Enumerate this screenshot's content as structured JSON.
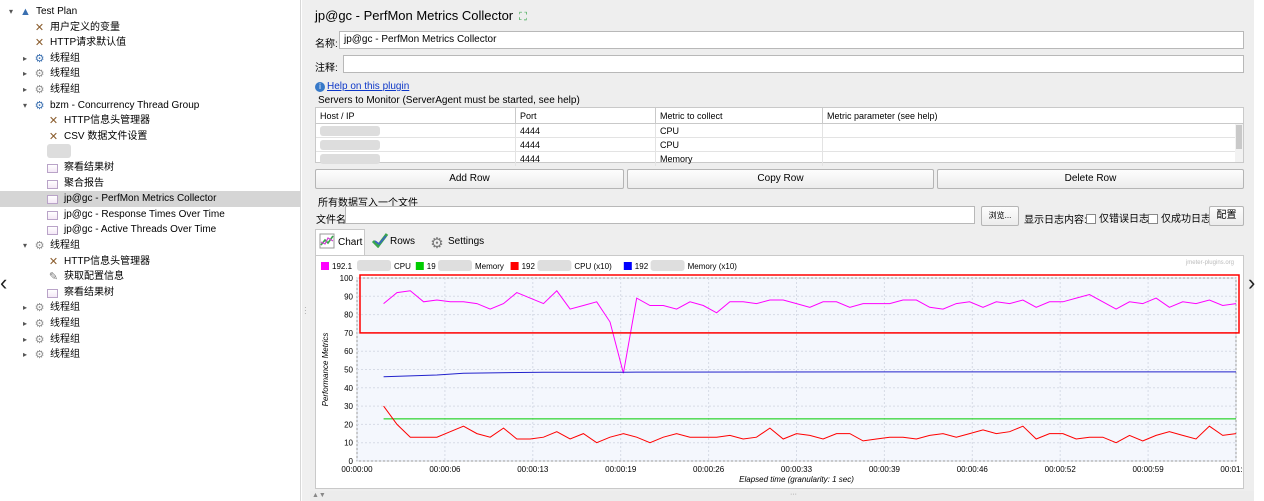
{
  "tree": {
    "items": [
      {
        "label": "Test Plan",
        "level": 0,
        "toggle": "▾",
        "icon": "test-plan-icon"
      },
      {
        "label": "用户定义的变量",
        "level": 1,
        "toggle": "",
        "icon": "wrench-icon"
      },
      {
        "label": "HTTP请求默认值",
        "level": 1,
        "toggle": "",
        "icon": "wrench-icon"
      },
      {
        "label": "线程组",
        "level": 1,
        "toggle": "▸",
        "icon": "gear-blue-icon"
      },
      {
        "label": "线程组",
        "level": 1,
        "toggle": "▸",
        "icon": "gear-icon"
      },
      {
        "label": "线程组",
        "level": 1,
        "toggle": "▸",
        "icon": "gear-icon"
      },
      {
        "label": "bzm - Concurrency Thread Group",
        "level": 1,
        "toggle": "▾",
        "icon": "gear-blue-icon"
      },
      {
        "label": "HTTP信息头管理器",
        "level": 2,
        "toggle": "",
        "icon": "wrench-icon"
      },
      {
        "label": "CSV 数据文件设置",
        "level": 2,
        "toggle": "",
        "icon": "wrench-icon"
      },
      {
        "label": "",
        "level": 2,
        "toggle": "",
        "icon": "redacted-icon"
      },
      {
        "label": "察看结果树",
        "level": 2,
        "toggle": "",
        "icon": "graph-icon"
      },
      {
        "label": "聚合报告",
        "level": 2,
        "toggle": "",
        "icon": "graph-icon"
      },
      {
        "label": "jp@gc - PerfMon Metrics Collector",
        "level": 2,
        "toggle": "",
        "icon": "graph-icon",
        "selected": true
      },
      {
        "label": "jp@gc - Response Times Over Time",
        "level": 2,
        "toggle": "",
        "icon": "graph-icon"
      },
      {
        "label": "jp@gc - Active Threads Over Time",
        "level": 2,
        "toggle": "",
        "icon": "graph-icon"
      },
      {
        "label": "线程组",
        "level": 1,
        "toggle": "▾",
        "icon": "gear-icon"
      },
      {
        "label": "HTTP信息头管理器",
        "level": 2,
        "toggle": "",
        "icon": "wrench-icon"
      },
      {
        "label": "获取配置信息",
        "level": 2,
        "toggle": "",
        "icon": "pen-icon"
      },
      {
        "label": "察看结果树",
        "level": 2,
        "toggle": "",
        "icon": "graph-icon"
      },
      {
        "label": "线程组",
        "level": 1,
        "toggle": "▸",
        "icon": "gear-icon"
      },
      {
        "label": "线程组",
        "level": 1,
        "toggle": "▸",
        "icon": "gear-icon"
      },
      {
        "label": "线程组",
        "level": 1,
        "toggle": "▸",
        "icon": "gear-icon"
      },
      {
        "label": "线程组",
        "level": 1,
        "toggle": "▸",
        "icon": "gear-icon"
      }
    ]
  },
  "panel": {
    "title": "jp@gc - PerfMon Metrics Collector",
    "name_label": "名称:",
    "name_value": "jp@gc - PerfMon Metrics Collector",
    "comment_label": "注释:",
    "comment_value": "",
    "help_link": "Help on this plugin",
    "servers_title": "Servers to Monitor (ServerAgent must be started, see help)",
    "table": {
      "headers": [
        "Host / IP",
        "Port",
        "Metric to collect",
        "Metric parameter (see help)"
      ],
      "rows": [
        [
          "",
          "4444",
          "CPU",
          ""
        ],
        [
          "",
          "4444",
          "CPU",
          ""
        ],
        [
          "",
          "4444",
          "Memory",
          ""
        ]
      ]
    },
    "buttons": {
      "add_row": "Add Row",
      "copy_row": "Copy Row",
      "delete_row": "Delete Row"
    },
    "file_section_title": "所有数据写入一个文件",
    "file_label": "文件名",
    "file_value": "",
    "browse": "浏览...",
    "log_label": "显示日志内容:",
    "errors_only": "仅错误日志",
    "success_only": "仅成功日志",
    "configure": "配置",
    "tabs": {
      "chart": "Chart",
      "rows": "Rows",
      "settings": "Settings"
    }
  },
  "chart_data": {
    "type": "line",
    "watermark": "jmeter-plugins.org",
    "ylabel": "Performance Metrics",
    "xlabel": "Elapsed time (granularity: 1 sec)",
    "ylim": [
      0,
      100
    ],
    "yticks": [
      0,
      10,
      20,
      30,
      40,
      50,
      60,
      70,
      80,
      90,
      100
    ],
    "xticks": [
      "00:00:00",
      "00:00:06",
      "00:00:13",
      "00:00:19",
      "00:00:26",
      "00:00:33",
      "00:00:39",
      "00:00:46",
      "00:00:52",
      "00:00:59",
      "00:01:06"
    ],
    "xmax_seconds": 66,
    "grid": true,
    "legend": [
      {
        "prefix": "192.1",
        "suffix": "CPU",
        "color": "#ff00ff"
      },
      {
        "prefix": "19",
        "suffix": "Memory",
        "color": "#00cc00"
      },
      {
        "prefix": "192",
        "suffix": "CPU (x10)",
        "color": "#ff0000"
      },
      {
        "prefix": "192",
        "suffix": "Memory (x10)",
        "color": "#0000ff"
      }
    ],
    "series": [
      {
        "color": "#ff00ff",
        "x": [
          2,
          3,
          4,
          5,
          6,
          7,
          8,
          9,
          10,
          11,
          12,
          13,
          14,
          15,
          16,
          17,
          18,
          19,
          20,
          21,
          22,
          23,
          24,
          25,
          26,
          27,
          28,
          29,
          30,
          31,
          32,
          33,
          34,
          35,
          36,
          37,
          38,
          39,
          40,
          41,
          42,
          43,
          44,
          45,
          46,
          47,
          48,
          49,
          50,
          51,
          52,
          53,
          54,
          55,
          56,
          57,
          58,
          59,
          60,
          61,
          62,
          63,
          64,
          65,
          66
        ],
        "y": [
          86,
          92,
          93,
          87,
          88,
          87,
          87,
          86,
          83,
          86,
          92,
          89,
          86,
          93,
          83,
          85,
          87,
          76,
          48,
          89,
          85,
          85,
          83,
          87,
          85,
          81,
          87,
          87,
          86,
          88,
          88,
          86,
          84,
          87,
          87,
          84,
          86,
          86,
          86,
          88,
          88,
          84,
          83,
          86,
          87,
          84,
          87,
          86,
          88,
          84,
          87,
          87,
          89,
          91,
          87,
          83,
          87,
          86,
          89,
          84,
          87,
          86,
          88,
          85,
          86
        ]
      },
      {
        "color": "#00cc00",
        "x": [
          2,
          66
        ],
        "y": [
          23,
          23
        ]
      },
      {
        "color": "#ff0000",
        "x": [
          2,
          3,
          4,
          5,
          6,
          7,
          8,
          9,
          10,
          11,
          12,
          13,
          14,
          15,
          16,
          17,
          18,
          19,
          20,
          21,
          22,
          23,
          24,
          25,
          26,
          27,
          28,
          29,
          30,
          31,
          32,
          33,
          34,
          35,
          36,
          37,
          38,
          39,
          40,
          41,
          42,
          43,
          44,
          45,
          46,
          47,
          48,
          49,
          50,
          51,
          52,
          53,
          54,
          55,
          56,
          57,
          58,
          59,
          60,
          61,
          62,
          63,
          64,
          65,
          66
        ],
        "y": [
          30,
          20,
          13,
          13,
          13,
          16,
          19,
          15,
          13,
          18,
          12,
          12,
          13,
          16,
          12,
          15,
          10,
          13,
          15,
          13,
          10,
          13,
          15,
          13,
          13,
          13,
          14,
          12,
          13,
          18,
          12,
          15,
          14,
          12,
          15,
          15,
          11,
          12,
          13,
          13,
          12,
          14,
          15,
          13,
          15,
          17,
          15,
          16,
          19,
          12,
          15,
          15,
          12,
          13,
          13,
          10,
          14,
          11,
          14,
          16,
          14,
          12,
          19,
          14,
          15
        ]
      },
      {
        "color": "#2222cc",
        "x": [
          2,
          6,
          8,
          14,
          20,
          40,
          60,
          66
        ],
        "y": [
          46,
          47,
          48,
          48.5,
          48.5,
          48.7,
          48.7,
          48.7
        ]
      }
    ],
    "annotation": {
      "type": "rect",
      "color": "#ff0000",
      "from_y": 70,
      "to_y": 100
    }
  }
}
